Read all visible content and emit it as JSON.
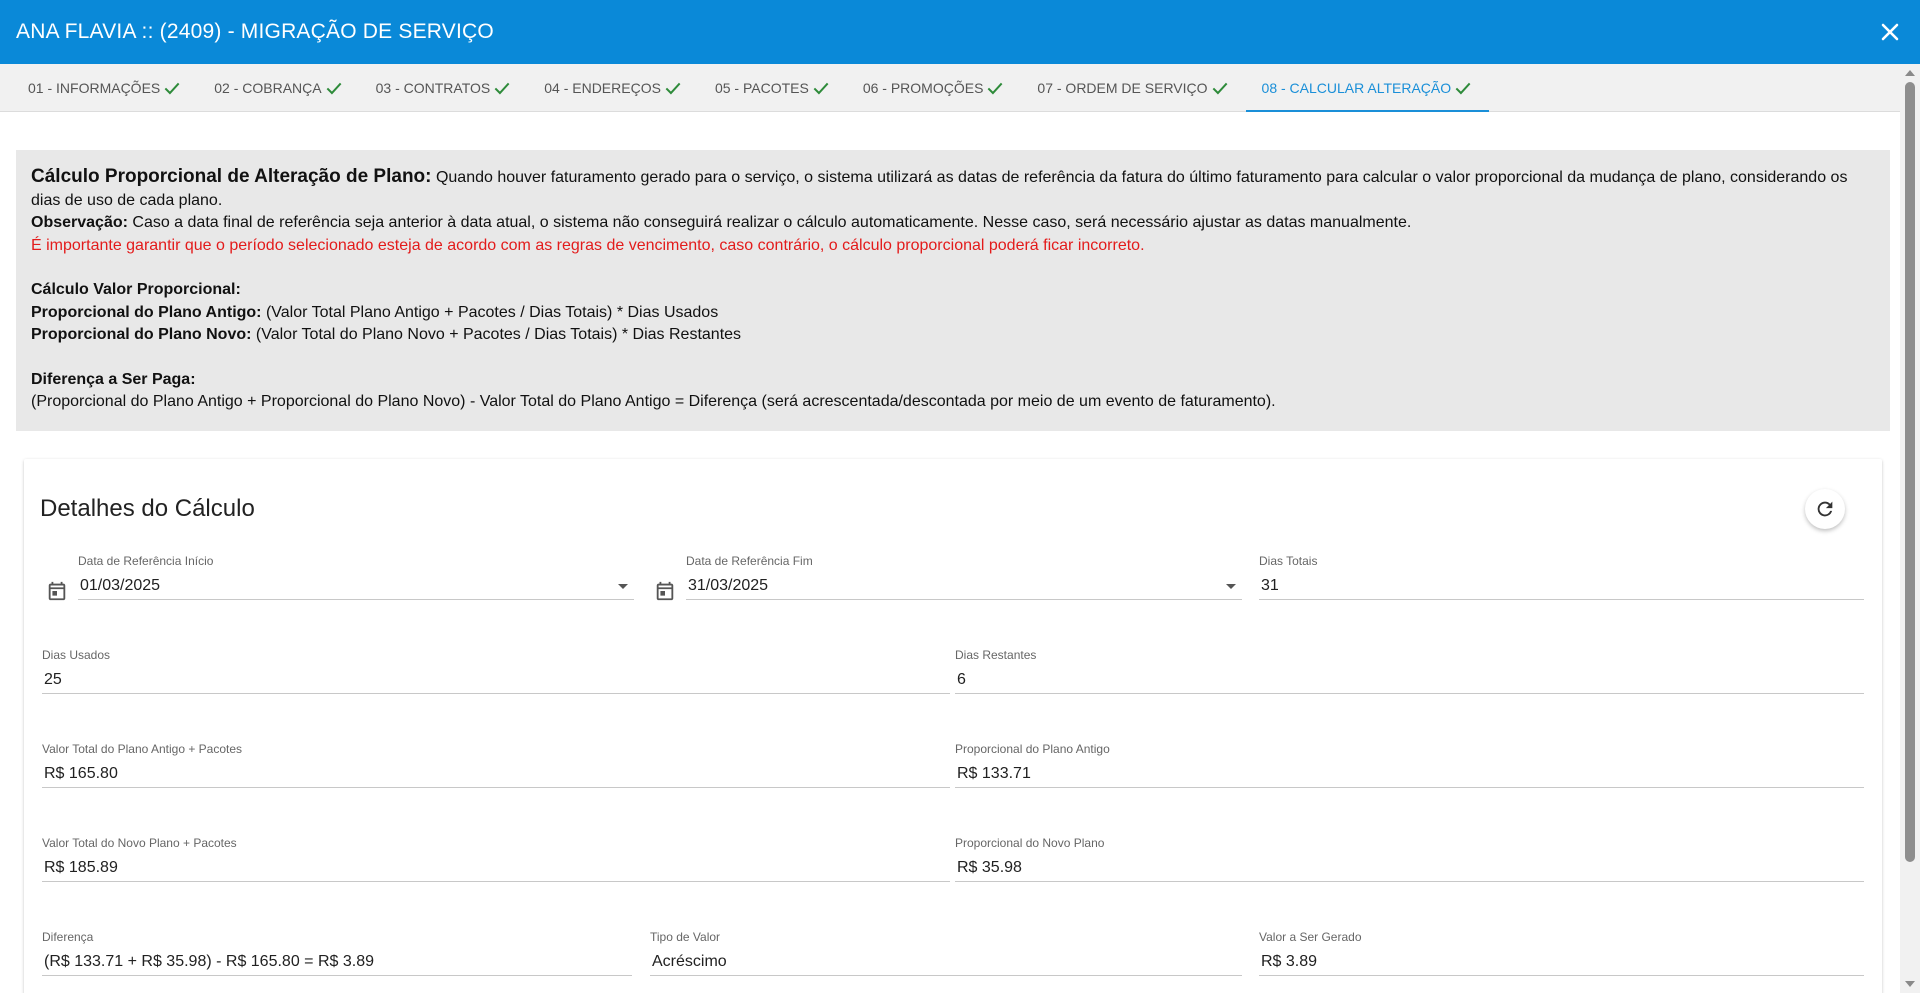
{
  "window": {
    "title": "ANA FLAVIA :: (2409) - MIGRAÇÃO DE SERVIÇO",
    "close_icon": "close-icon"
  },
  "tabs": [
    {
      "label": "01 - INFORMAÇÕES",
      "done": true
    },
    {
      "label": "02 - COBRANÇA",
      "done": true
    },
    {
      "label": "03 - CONTRATOS",
      "done": true
    },
    {
      "label": "04 - ENDEREÇOS",
      "done": true
    },
    {
      "label": "05 - PACOTES",
      "done": true
    },
    {
      "label": "06 - PROMOÇÕES",
      "done": true
    },
    {
      "label": "07 - ORDEM DE SERVIÇO",
      "done": true
    },
    {
      "label": "08 - CALCULAR ALTERAÇÃO",
      "done": true,
      "active": true
    }
  ],
  "info": {
    "heading": "Cálculo Proporcional de Alteração de Plano:",
    "heading_text": " Quando houver faturamento gerado para o serviço, o sistema utilizará as datas de referência da fatura do último faturamento para calcular o valor proporcional da mudança de plano, considerando os dias de uso de cada plano.",
    "obs_label": "Observação:",
    "obs_text": " Caso a data final de referência seja anterior à data atual, o sistema não conseguirá realizar o cálculo automaticamente. Nesse caso, será necessário ajustar as datas manualmente.",
    "warning": "É importante garantir que o período selecionado esteja de acordo com as regras de vencimento, caso contrário, o cálculo proporcional poderá ficar incorreto.",
    "calc_title": "Cálculo Valor Proporcional:",
    "old_label": "Proporcional do Plano Antigo:",
    "old_formula": " (Valor Total Plano Antigo + Pacotes / Dias Totais) * Dias Usados",
    "new_label": "Proporcional do Plano Novo:",
    "new_formula": " (Valor Total do Plano Novo + Pacotes / Dias Totais) * Dias Restantes",
    "diff_title": "Diferença a Ser Paga:",
    "diff_formula": "(Proporcional do Plano Antigo + Proporcional do Plano Novo) - Valor Total do Plano Antigo = Diferença (será acrescentada/descontada por meio de um evento de faturamento)."
  },
  "details": {
    "title": "Detalhes do Cálculo",
    "refresh_icon": "refresh-icon",
    "ref_start": {
      "label": "Data de Referência Início",
      "value": "01/03/2025"
    },
    "ref_end": {
      "label": "Data de Referência Fim",
      "value": "31/03/2025"
    },
    "total_days": {
      "label": "Dias Totais",
      "value": "31"
    },
    "used_days": {
      "label": "Dias Usados",
      "value": "25"
    },
    "remaining_days": {
      "label": "Dias Restantes",
      "value": "6"
    },
    "old_total": {
      "label": "Valor Total do Plano Antigo + Pacotes",
      "value": "R$ 165.80"
    },
    "old_prop": {
      "label": "Proporcional do Plano Antigo",
      "value": "R$ 133.71"
    },
    "new_total": {
      "label": "Valor Total do Novo Plano + Pacotes",
      "value": "R$ 185.89"
    },
    "new_prop": {
      "label": "Proporcional do Novo Plano",
      "value": "R$ 35.98"
    },
    "difference": {
      "label": "Diferença",
      "value": "(R$ 133.71 + R$ 35.98) - R$ 165.80 = R$ 3.89"
    },
    "value_type": {
      "label": "Tipo de Valor",
      "value": "Acréscimo"
    },
    "value_generated": {
      "label": "Valor a Ser Gerado",
      "value": "R$ 3.89"
    }
  },
  "colors": {
    "header": "#0a89d8",
    "active_tab": "#1a8fd8",
    "check": "#2e8b3a",
    "warning": "#e31b1b",
    "info_bg": "#e8e8e8"
  }
}
